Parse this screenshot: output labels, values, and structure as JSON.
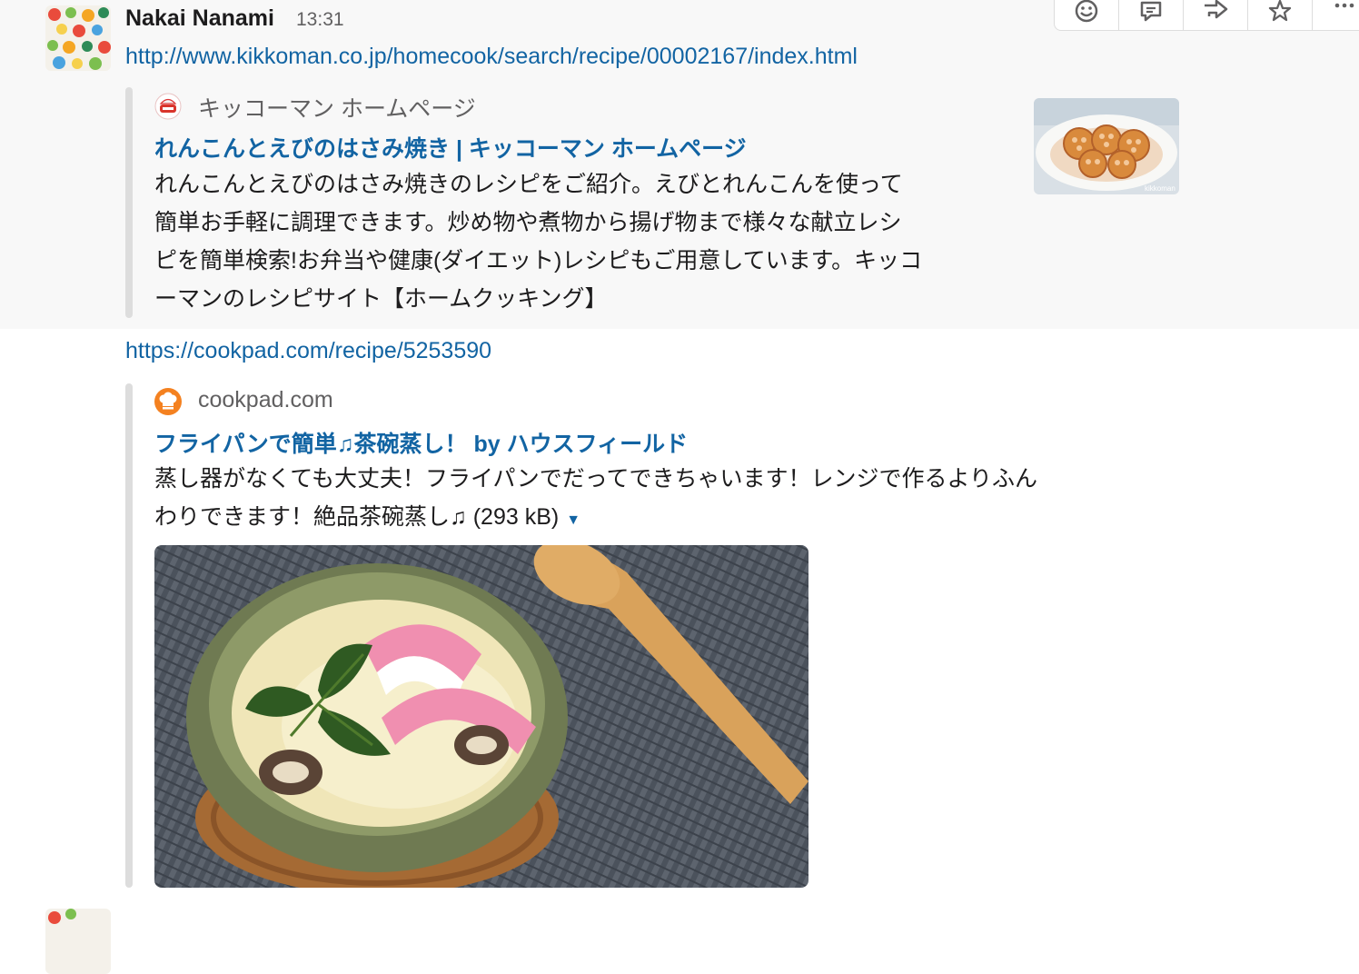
{
  "message": {
    "sender": "Nakai Nanami",
    "time": "13:31",
    "link1": "http://www.kikkoman.co.jp/homecook/search/recipe/00002167/index.html",
    "link2": "https://cookpad.com/recipe/5253590"
  },
  "attachment1": {
    "service_name": "キッコーマン ホームページ",
    "service_icon": "recipe-badge-icon",
    "title": "れんこんとえびのはさみ焼き | キッコーマン ホームページ",
    "text_lines": [
      "れんこんとえびのはさみ焼きのレシピをご紹介。えびとれんこんを使って",
      "簡単お手軽に調理できます。炒め物や煮物から揚げ物まで様々な献立レシ",
      "ピを簡単検索!お弁当や健康(ダイエット)レシピもご用意しています。キッコ",
      "ーマンのレシピサイト【ホームクッキング】"
    ],
    "thumb_watermark": "kikkoman"
  },
  "attachment2": {
    "service_name": "cookpad.com",
    "service_icon": "chef-hat-icon",
    "title": "フライパンで簡単♫茶碗蒸し！ by ハウスフィールド",
    "text_line1": "蒸し器がなくても大丈夫！フライパンでだってできちゃいます！レンジで作るよりふん",
    "text_line2": "わりできます！絶品茶碗蒸し♫",
    "file_size": "(293 kB)"
  },
  "actions": [
    "emoji-reaction-icon",
    "thread-reply-icon",
    "share-icon",
    "star-icon",
    "more-icon"
  ],
  "colors": {
    "link": "#1264a3",
    "hover_bg": "#f8f8f8",
    "bar": "#dddddd",
    "cookpad": "#f48120"
  }
}
